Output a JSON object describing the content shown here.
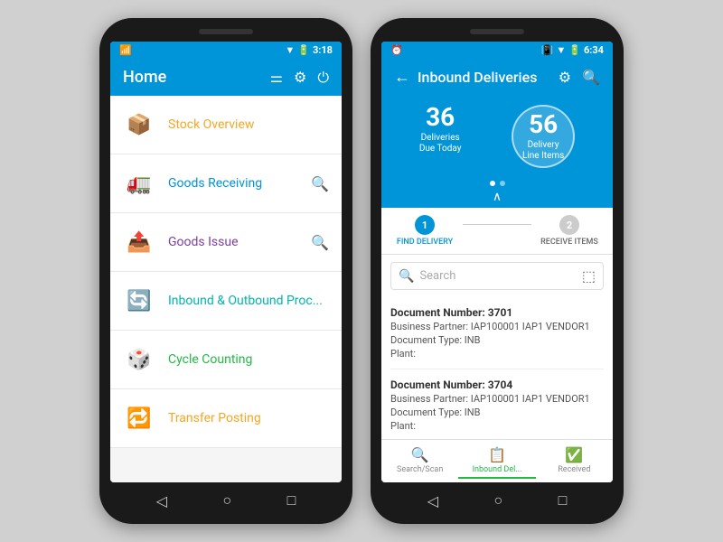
{
  "phone1": {
    "statusBar": {
      "left": "📱",
      "time": "3:18",
      "icons": "▼ 🔋"
    },
    "header": {
      "title": "Home",
      "icons": [
        "filter-icon",
        "settings-icon",
        "power-icon"
      ]
    },
    "menuItems": [
      {
        "id": "stock-overview",
        "label": "Stock Overview",
        "color": "orange",
        "icon": "📦",
        "hasSearch": false
      },
      {
        "id": "goods-receiving",
        "label": "Goods Receiving",
        "color": "blue",
        "icon": "🚛",
        "hasSearch": true
      },
      {
        "id": "goods-issue",
        "label": "Goods Issue",
        "color": "purple",
        "icon": "📤",
        "hasSearch": true
      },
      {
        "id": "inbound-outbound",
        "label": "Inbound & Outbound Proc...",
        "color": "teal",
        "icon": "🔄",
        "hasSearch": false
      },
      {
        "id": "cycle-counting",
        "label": "Cycle Counting",
        "color": "green",
        "icon": "🎲",
        "hasSearch": false
      },
      {
        "id": "transfer-posting",
        "label": "Transfer Posting",
        "color": "orange",
        "icon": "🔁",
        "hasSearch": false
      }
    ]
  },
  "phone2": {
    "statusBar": {
      "time": "6:34"
    },
    "header": {
      "backLabel": "←",
      "title": "Inbound Deliveries"
    },
    "stats": {
      "deliveries": {
        "number": "36",
        "label": "Deliveries\nDue Today"
      },
      "lineItems": {
        "number": "56",
        "label": "Delivery Line Items"
      }
    },
    "steps": [
      {
        "number": "1",
        "label": "FIND DELIVERY",
        "active": true
      },
      {
        "number": "2",
        "label": "Receive Items",
        "active": false
      }
    ],
    "searchPlaceholder": "Search",
    "documents": [
      {
        "title": "Document Number: 3701",
        "partner": "Business Partner: IAP100001  IAP1 VENDOR1",
        "type": "Document Type: INB",
        "plant": "Plant:"
      },
      {
        "title": "Document Number: 3704",
        "partner": "Business Partner: IAP100001  IAP1 VENDOR1",
        "type": "Document Type: INB",
        "plant": "Plant:"
      }
    ],
    "bottomNav": [
      {
        "id": "search-scan",
        "label": "Search/Scan",
        "icon": "🔍",
        "active": false
      },
      {
        "id": "inbound-del",
        "label": "Inbound Del...",
        "icon": "📋",
        "active": true,
        "activeColor": "green"
      },
      {
        "id": "received",
        "label": "Received",
        "icon": "✅",
        "active": false
      }
    ]
  }
}
